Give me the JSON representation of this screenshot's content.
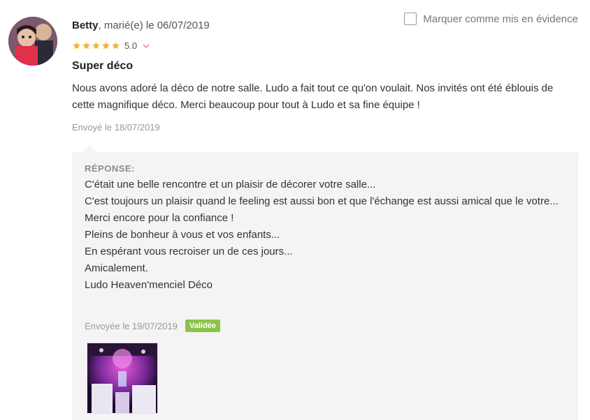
{
  "review": {
    "author": "Betty",
    "author_suffix": ", marié(e) le 06/07/2019",
    "rating": "5.0",
    "stars": 5,
    "title": "Super déco",
    "body": "Nous avons adoré la déco de notre salle. Ludo a fait tout ce qu'on voulait. Nos invités ont été éblouis de cette magnifique déco. Merci beaucoup pour tout à Ludo et sa fine équipe !",
    "sent": "Envoyé le 18/07/2019"
  },
  "highlight": {
    "label": "Marquer comme mis en évidence",
    "checked": false
  },
  "reply": {
    "label": "RÉPONSE:",
    "lines": [
      "C'était une belle rencontre et un plaisir de décorer votre salle...",
      "C'est toujours un plaisir quand le feeling est aussi bon et que l'échange est aussi amical que le votre...",
      "Merci encore pour la confiance !",
      "Pleins de bonheur à vous et vos enfants...",
      "En espérant vous recroiser un de ces jours...",
      "Amicalement.",
      "Ludo Heaven'menciel Déco"
    ],
    "sent": "Envoyée le 19/07/2019",
    "status": "Validée"
  },
  "icons": {
    "star": "star-icon",
    "chevron": "chevron-down-icon",
    "checkbox": "checkbox"
  },
  "colors": {
    "star": "#f5b42a",
    "chevron": "#e86a8a",
    "badge": "#8bc34a",
    "reply_bg": "#f4f4f4"
  }
}
